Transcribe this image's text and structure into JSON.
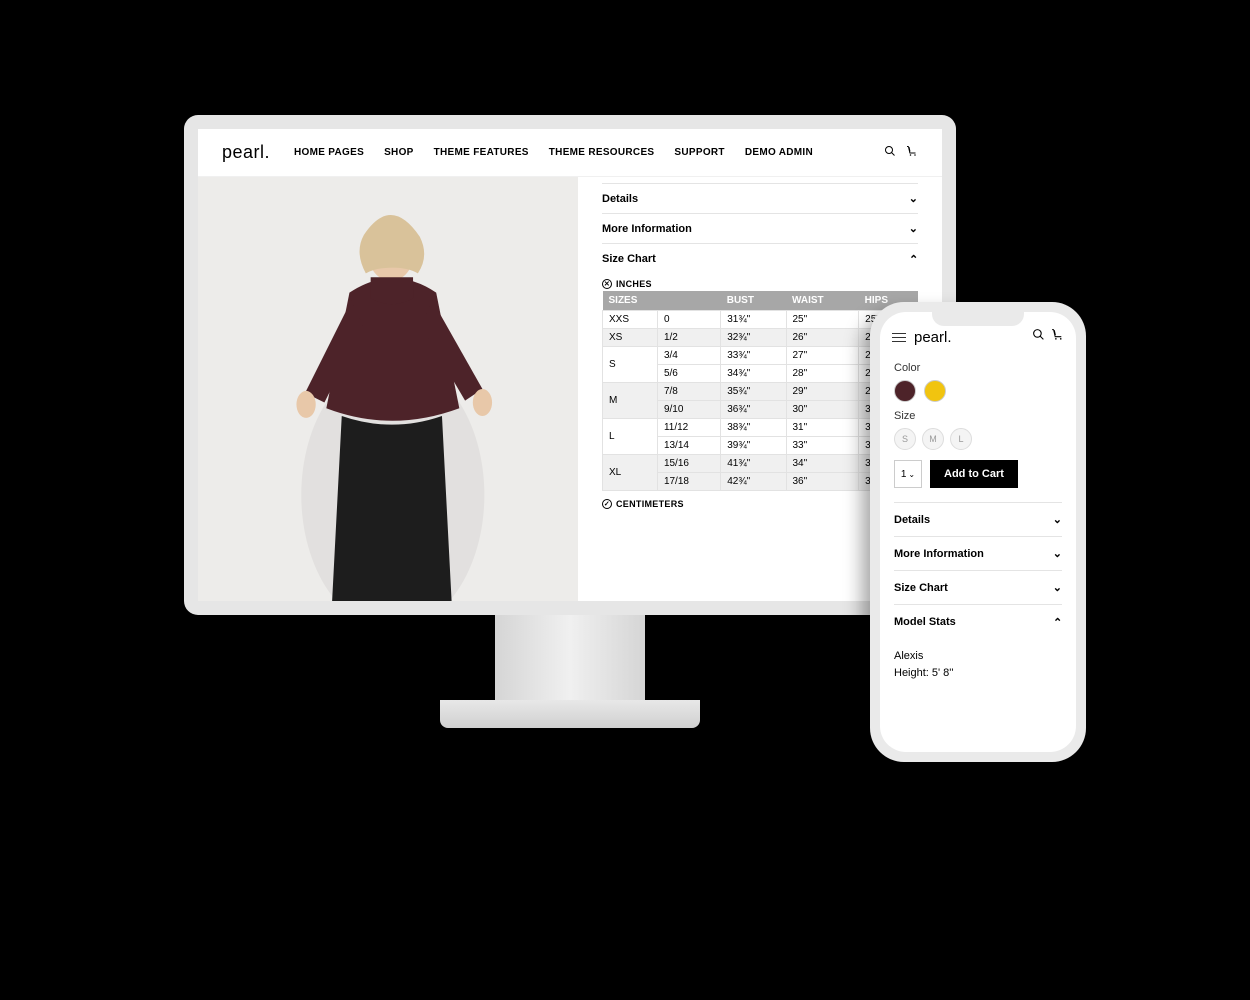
{
  "desktop": {
    "logo": "pearl.",
    "nav": [
      "HOME PAGES",
      "SHOP",
      "THEME FEATURES",
      "THEME RESOURCES",
      "SUPPORT",
      "DEMO ADMIN"
    ],
    "accordions": {
      "details": "Details",
      "more_info": "More Information",
      "size_chart": "Size Chart"
    },
    "units_inches": "INCHES",
    "units_cm": "CENTIMETERS",
    "table": {
      "headers": [
        "SIZES",
        "",
        "BUST",
        "WAIST",
        "HIPS"
      ],
      "rows": [
        {
          "size": "XXS",
          "sub": "0",
          "bust": "31¾\"",
          "waist": "25\"",
          "hips": "25\"",
          "gr": false
        },
        {
          "size": "XS",
          "sub": "1/2",
          "bust": "32¾\"",
          "waist": "26\"",
          "hips": "26\"",
          "gr": true
        },
        {
          "size": "S",
          "sub": "3/4",
          "bust": "33¾\"",
          "waist": "27\"",
          "hips": "27\"",
          "gr": false,
          "span": 2
        },
        {
          "size": "",
          "sub": "5/6",
          "bust": "34¾\"",
          "waist": "28\"",
          "hips": "28\"",
          "gr": false
        },
        {
          "size": "M",
          "sub": "7/8",
          "bust": "35¾\"",
          "waist": "29\"",
          "hips": "29\"",
          "gr": true,
          "span": 2
        },
        {
          "size": "",
          "sub": "9/10",
          "bust": "36¾\"",
          "waist": "30\"",
          "hips": "30\"",
          "gr": true
        },
        {
          "size": "L",
          "sub": "11/12",
          "bust": "38¾\"",
          "waist": "31\"",
          "hips": "31\"",
          "gr": false,
          "span": 2
        },
        {
          "size": "",
          "sub": "13/14",
          "bust": "39¾\"",
          "waist": "33\"",
          "hips": "33\"",
          "gr": false
        },
        {
          "size": "XL",
          "sub": "15/16",
          "bust": "41¾\"",
          "waist": "34\"",
          "hips": "34\"",
          "gr": true,
          "span": 2
        },
        {
          "size": "",
          "sub": "17/18",
          "bust": "42¾\"",
          "waist": "36\"",
          "hips": "36\"",
          "gr": true
        }
      ]
    }
  },
  "phone": {
    "logo": "pearl.",
    "color_label": "Color",
    "colors": [
      {
        "name": "maroon",
        "hex": "#4d2329"
      },
      {
        "name": "gold",
        "hex": "#f1c40f"
      }
    ],
    "size_label": "Size",
    "sizes": [
      "S",
      "M",
      "L"
    ],
    "qty": "1",
    "add_to_cart": "Add to Cart",
    "accordions": {
      "details": "Details",
      "more_info": "More Information",
      "size_chart": "Size Chart",
      "model_stats": "Model Stats"
    },
    "stats_name": "Alexis",
    "stats_height": "Height: 5' 8''"
  }
}
